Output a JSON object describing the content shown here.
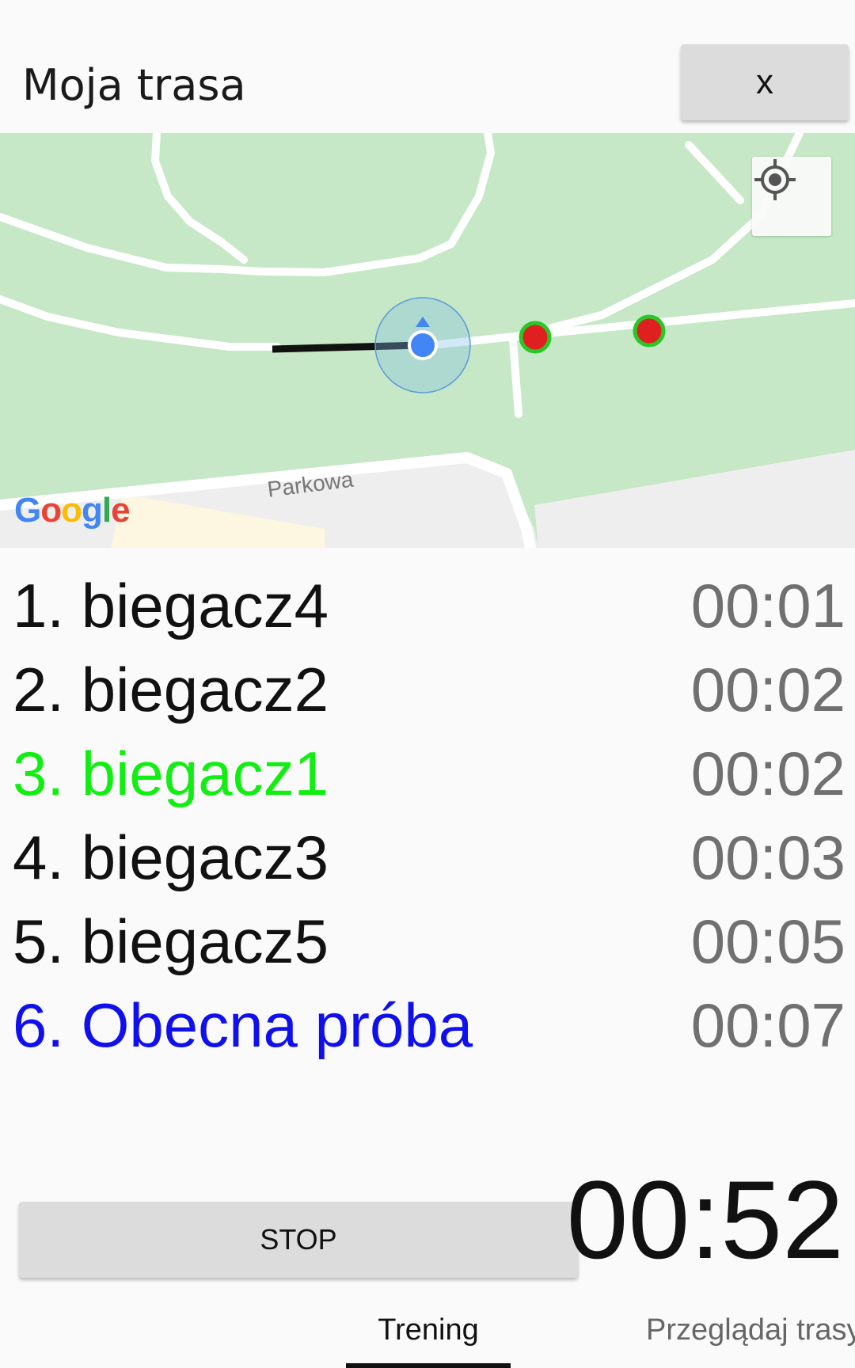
{
  "header": {
    "title": "Moja trasa",
    "close_label": "x"
  },
  "map": {
    "street_label": "Parkowa",
    "logo_text": "Google",
    "locate_icon": "my-location-icon",
    "colors": {
      "park": "#c6e8c6",
      "road": "#ffffff",
      "marker": "#e02020",
      "marker_ring": "#28c828",
      "user_dot": "#4285f4"
    }
  },
  "leaderboard": [
    {
      "rank_name": "1. biegacz4",
      "time": "00:01",
      "color": "#111111"
    },
    {
      "rank_name": "2. biegacz2",
      "time": "00:02",
      "color": "#111111"
    },
    {
      "rank_name": "3. biegacz1",
      "time": "00:02",
      "color": "#11ee11"
    },
    {
      "rank_name": "4. biegacz3",
      "time": "00:03",
      "color": "#111111"
    },
    {
      "rank_name": "5. biegacz5",
      "time": "00:05",
      "color": "#111111"
    },
    {
      "rank_name": "6. Obecna próba",
      "time": "00:07",
      "color": "#1010ee"
    }
  ],
  "controls": {
    "stop_label": "STOP",
    "timer": "00:52"
  },
  "tabs": {
    "active": "Trening",
    "other": "Przeglądaj trasy"
  }
}
